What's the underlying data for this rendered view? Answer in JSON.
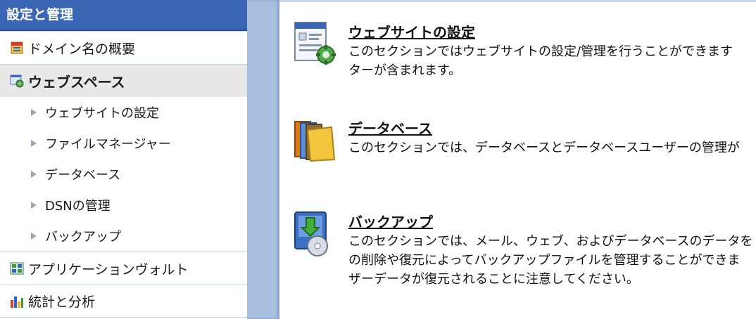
{
  "sidebar": {
    "header": "設定と管理",
    "items": [
      {
        "label": "ドメイン名の概要",
        "icon": "domain-overview-icon"
      },
      {
        "label": "ウェブスペース",
        "icon": "webspace-icon",
        "active": true
      },
      {
        "label": "アプリケーションヴォルト",
        "icon": "application-vault-icon"
      },
      {
        "label": "統計と分析",
        "icon": "statistics-chart-icon"
      }
    ],
    "subitems": [
      {
        "label": "ウェブサイトの設定"
      },
      {
        "label": "ファイルマネージャー"
      },
      {
        "label": "データベース"
      },
      {
        "label": "DSNの管理"
      },
      {
        "label": "バックアップ"
      }
    ]
  },
  "sections": [
    {
      "title": "ウェブサイトの設定",
      "icon": "website-settings-icon",
      "desc1": "このセクションではウェブサイトの設定/管理を行うことができます",
      "desc2": "ターが含まれます。"
    },
    {
      "title": "データベース",
      "icon": "database-folder-icon",
      "desc1": "このセクションでは、データベースとデータベースユーザーの管理が"
    },
    {
      "title": "バックアップ",
      "icon": "backup-icon",
      "desc1": "このセクションでは、メール、ウェブ、およびデータベースのデータを",
      "desc2": "の削除や復元によってバックアップファイルを管理することができま",
      "desc3": "ザーデータが復元されることに注意してください。"
    }
  ],
  "colors": {
    "sidebar_header": "#3a66b5",
    "background": "#a8bfe0",
    "active_item": "#e8e8e8"
  }
}
